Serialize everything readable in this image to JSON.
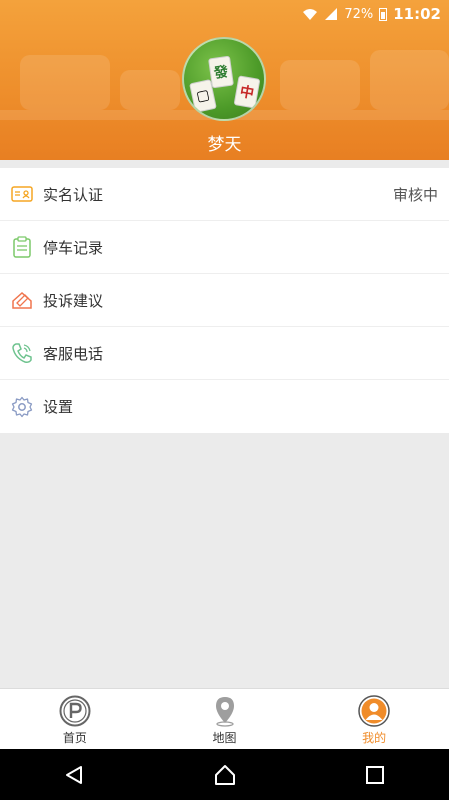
{
  "status_bar": {
    "battery": "72%",
    "time": "11:02"
  },
  "profile": {
    "username": "梦天"
  },
  "menu": [
    {
      "label": "实名认证",
      "status": "审核中",
      "icon": "id-card-icon",
      "color": "#f5a623"
    },
    {
      "label": "停车记录",
      "icon": "clipboard-icon",
      "color": "#7cc96a"
    },
    {
      "label": "投诉建议",
      "icon": "pencil-envelope-icon",
      "color": "#f0754e"
    },
    {
      "label": "客服电话",
      "icon": "phone-icon",
      "color": "#6fc38f"
    },
    {
      "label": "设置",
      "icon": "gear-icon",
      "color": "#8a9bc4"
    }
  ],
  "tabs": [
    {
      "label": "首页",
      "icon": "parking-icon",
      "active": false
    },
    {
      "label": "地图",
      "icon": "map-pin-icon",
      "active": false
    },
    {
      "label": "我的",
      "icon": "user-icon",
      "active": true
    }
  ],
  "theme": {
    "accent": "#f08c2a"
  }
}
